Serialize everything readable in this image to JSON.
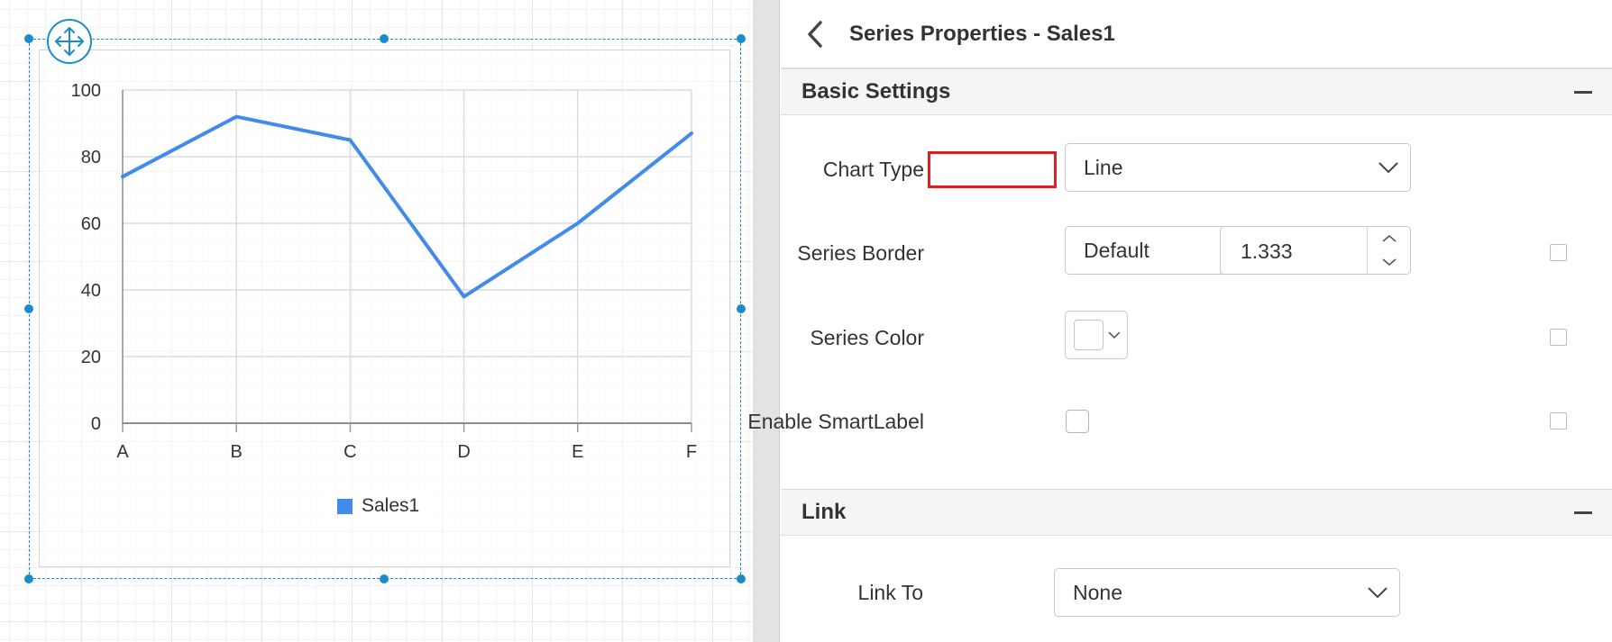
{
  "chart_data": {
    "type": "line",
    "categories": [
      "A",
      "B",
      "C",
      "D",
      "E",
      "F"
    ],
    "series": [
      {
        "name": "Sales1",
        "values": [
          74,
          92,
          85,
          38,
          60,
          87
        ],
        "color": "#428bea"
      }
    ],
    "y_ticks": [
      "0",
      "20",
      "40",
      "60",
      "80",
      "100"
    ],
    "ylim": [
      0,
      100
    ],
    "grid": true,
    "legend": "bottom",
    "title": "",
    "xlabel": "",
    "ylabel": ""
  },
  "panel": {
    "title": "Series Properties - Sales1",
    "back_icon": "chevron-left-icon",
    "sections": {
      "basic": {
        "title": "Basic Settings",
        "chart_type": {
          "label": "Chart Type",
          "value": "Line"
        },
        "series_border": {
          "label": "Series Border",
          "style": "Default",
          "width": "1.333",
          "color": "#ffffff"
        },
        "series_color": {
          "label": "Series Color",
          "color": "#ffffff"
        },
        "smart_label": {
          "label": "Enable SmartLabel",
          "checked": false
        }
      },
      "link": {
        "title": "Link",
        "link_to": {
          "label": "Link To",
          "value": "None"
        }
      }
    }
  },
  "colors": {
    "accent": "#1a8ccc",
    "series": "#428bea",
    "highlight": "#e31b23"
  }
}
